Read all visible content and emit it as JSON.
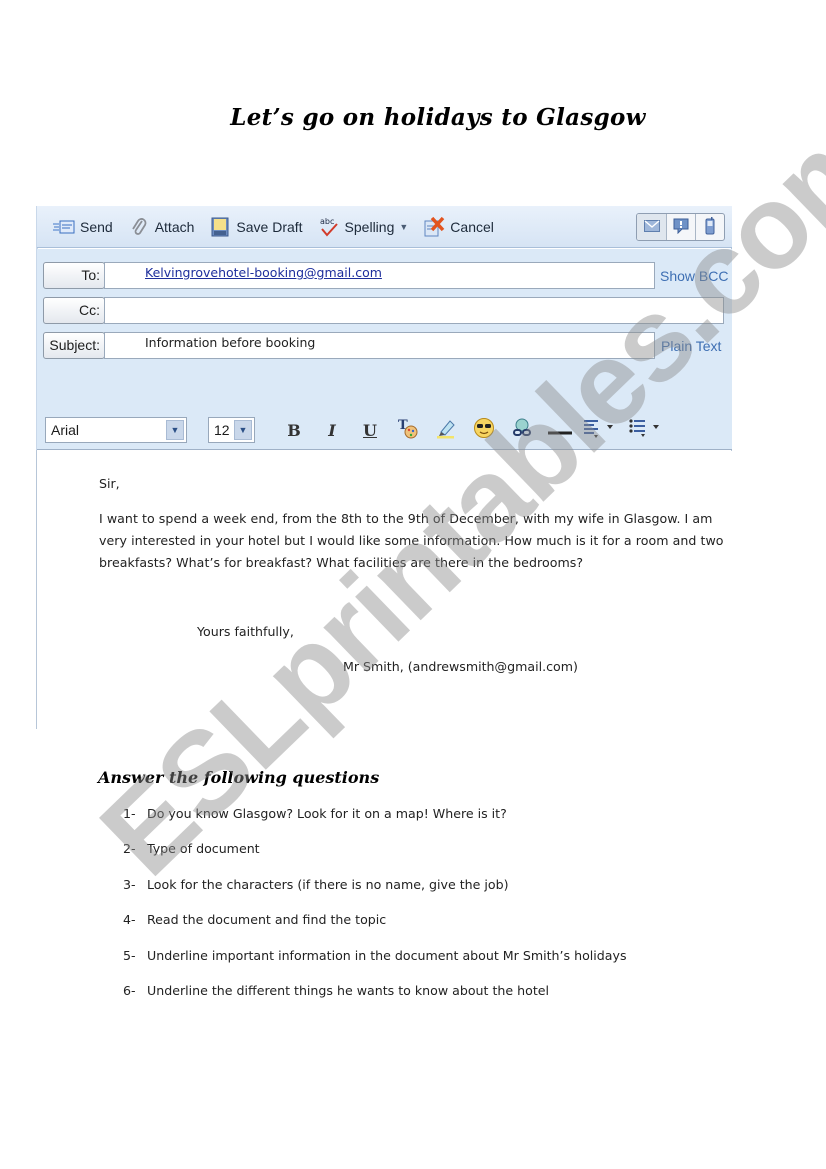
{
  "page": {
    "title": "Let’s go on holidays to Glasgow"
  },
  "email": {
    "toolbar": {
      "send": "Send",
      "attach": "Attach",
      "save_draft": "Save Draft",
      "spelling": "Spelling",
      "cancel": "Cancel",
      "view_modes": [
        "email-icon",
        "message-icon",
        "mobile-icon"
      ]
    },
    "fields": {
      "to_label": "To:",
      "to_value": "Kelvingrovehotel-booking@gmail.com",
      "cc_label": "Cc:",
      "cc_value": "",
      "subject_label": "Subject:",
      "subject_value": "Information before booking",
      "show_bcc": "Show BCC",
      "plain_text": "Plain Text"
    },
    "format": {
      "font": "Arial",
      "size": "12",
      "bold": "B",
      "italic": "I",
      "underline": "U"
    },
    "body": {
      "greeting": "Sir,",
      "paragraph": "I want to spend a week end, from the 8th to the 9th of December, with my wife in Glasgow. I am very interested in your hotel but I would like some information. How much is it for a room and two breakfasts? What’s for breakfast? What facilities are there in the bedrooms?",
      "closing": "Yours faithfully,",
      "signature": "Mr Smith, (andrewsmith@gmail.com)"
    }
  },
  "questions": {
    "title": "Answer the following questions",
    "items": [
      {
        "num": "1-",
        "text": "Do you know Glasgow? Look for it on a map! Where is it?"
      },
      {
        "num": "2-",
        "text": "Type of document"
      },
      {
        "num": "3-",
        "text": "Look for the characters (if there is no name, give the job)"
      },
      {
        "num": "4-",
        "text": "Read the document and find the topic"
      },
      {
        "num": "5-",
        "text": "Underline important information in the document about Mr Smith’s holidays"
      },
      {
        "num": "6-",
        "text": "Underline the different things he wants to know about the hotel"
      }
    ]
  },
  "watermark": "ESLprintables.com"
}
